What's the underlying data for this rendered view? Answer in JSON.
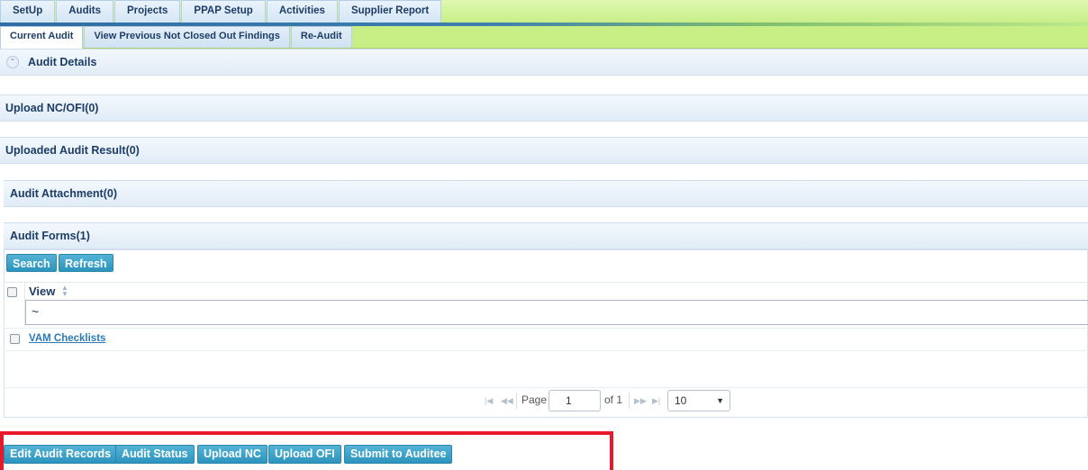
{
  "menu": [
    "SetUp",
    "Audits",
    "Projects",
    "PPAP Setup",
    "Activities",
    "Supplier Report"
  ],
  "subtabs": [
    "Current Audit",
    "View Previous Not Closed Out Findings",
    "Re-Audit"
  ],
  "sections": {
    "audit_details": "Audit Details",
    "upload_nc_ofi": "Upload NC/OFI(0)",
    "uploaded_result": "Uploaded Audit Result(0)",
    "attachment": "Audit Attachment(0)",
    "forms": "Audit Forms(1)"
  },
  "grid": {
    "search_label": "Search",
    "refresh_label": "Refresh",
    "column_view": "View",
    "filter_value": "~",
    "rows": [
      "VAM Checklists"
    ]
  },
  "pager": {
    "page_label": "Page",
    "page_value": "1",
    "of_label": "of 1",
    "page_size": "10"
  },
  "actions": [
    "Edit Audit Records",
    "Audit Status",
    "Upload NC",
    "Upload OFI",
    "Submit to Auditee"
  ],
  "colors": {
    "accent": "#2d94bd",
    "highlight": "#e8192a",
    "menu_bg": "#c8ee86"
  }
}
